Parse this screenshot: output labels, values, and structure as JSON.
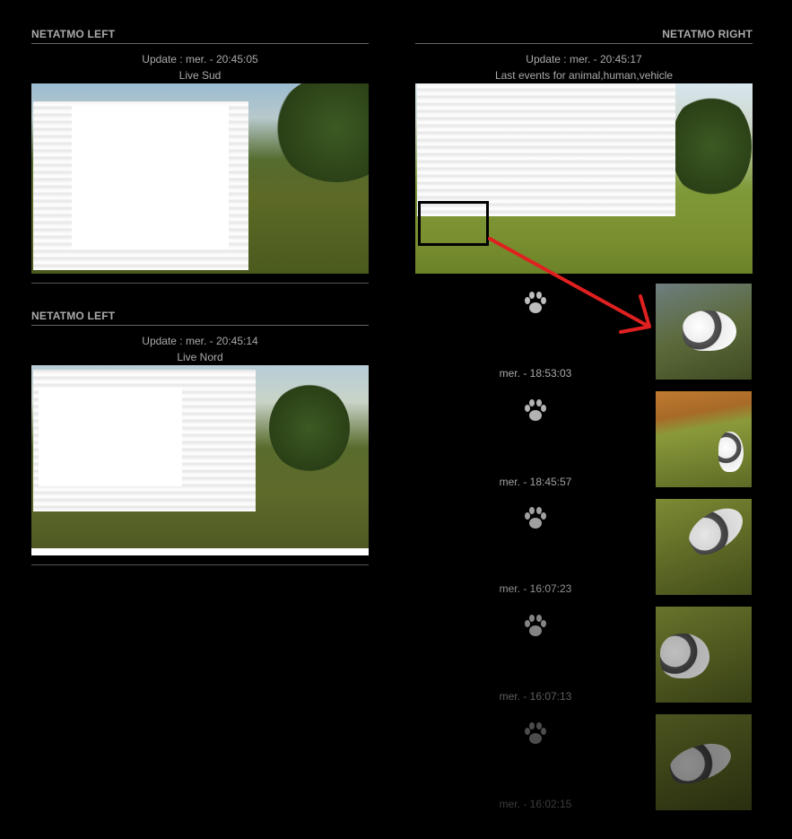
{
  "left_top": {
    "title": "NETATMO LEFT",
    "update": "Update : mer. - 20:45:05",
    "caption": "Live Sud"
  },
  "left_bottom": {
    "title": "NETATMO LEFT",
    "update": "Update : mer. - 20:45:14",
    "caption": "Live Nord"
  },
  "right": {
    "title": "NETATMO RIGHT",
    "update": "Update : mer. - 20:45:17",
    "caption": "Last events for animal,human,vehicle",
    "events": [
      {
        "icon": "paw-icon",
        "time": "mer. - 18:53:03"
      },
      {
        "icon": "paw-icon",
        "time": "mer. - 18:45:57"
      },
      {
        "icon": "paw-icon",
        "time": "mer. - 16:07:23"
      },
      {
        "icon": "paw-icon",
        "time": "mer. - 16:07:13"
      },
      {
        "icon": "paw-icon",
        "time": "mer. - 16:02:15"
      }
    ]
  },
  "colors": {
    "background": "#000000",
    "text": "#aaaaaa",
    "annotation": "#e02020"
  }
}
